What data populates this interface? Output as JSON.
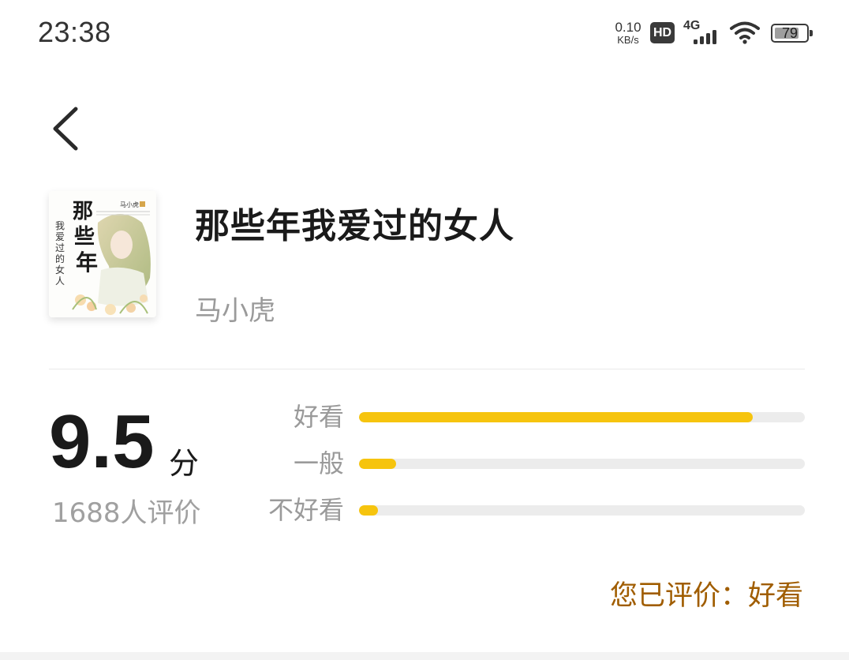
{
  "status_bar": {
    "time": "23:38",
    "net_speed_value": "0.10",
    "net_speed_unit": "KB/s",
    "hd_label": "HD",
    "network_type": "4G",
    "battery_level": "79",
    "battery_fraction": 0.79
  },
  "navigation": {
    "back_icon": "chevron-left-icon"
  },
  "book": {
    "title": "那些年我爱过的女人",
    "author": "马小虎",
    "cover_title_art": "那些年",
    "cover_subtitle_art": "我爱过的女人",
    "cover_author_art": "马小虎"
  },
  "rating": {
    "score": "9.5",
    "score_unit": "分",
    "review_count": "1688人评价",
    "breakdown": [
      {
        "label": "好看",
        "fraction": 0.883
      },
      {
        "label": "一般",
        "fraction": 0.083
      },
      {
        "label": "不好看",
        "fraction": 0.042
      }
    ],
    "bar_color": "#f6c40e",
    "track_color": "#ececec",
    "user_rating_text": "您已评价：好看",
    "user_rating_color": "#a05d00"
  }
}
